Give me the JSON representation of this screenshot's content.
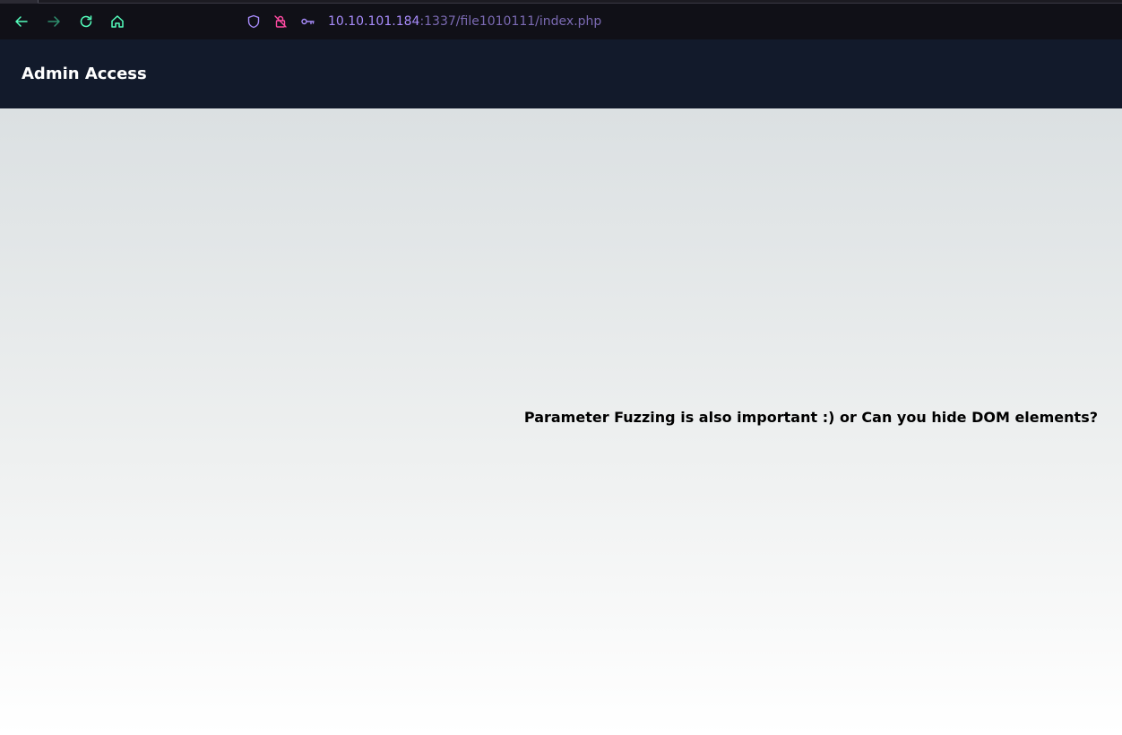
{
  "browser": {
    "url": {
      "host": "10.10.101.184",
      "path": ":1337/file1010111/index.php"
    },
    "icons": {
      "back": "arrow-left-icon",
      "forward": "arrow-right-icon",
      "reload": "reload-icon",
      "home": "home-icon",
      "tracking": "shield-icon",
      "insecure": "lock-slash-icon",
      "key": "key-icon"
    },
    "colors": {
      "toolbar_bg": "#101017",
      "nav_accent": "#54ffbd",
      "url_host": "#a78bfa",
      "url_path": "#7b6ab3"
    }
  },
  "page": {
    "header": {
      "title": "Admin Access"
    },
    "hint": "Parameter Fuzzing is also important :) or Can you hide DOM elements?",
    "colors": {
      "header_bg": "#121a2b",
      "body_gradient_top": "#dbe0e2",
      "body_gradient_bottom": "#ffffff"
    }
  }
}
